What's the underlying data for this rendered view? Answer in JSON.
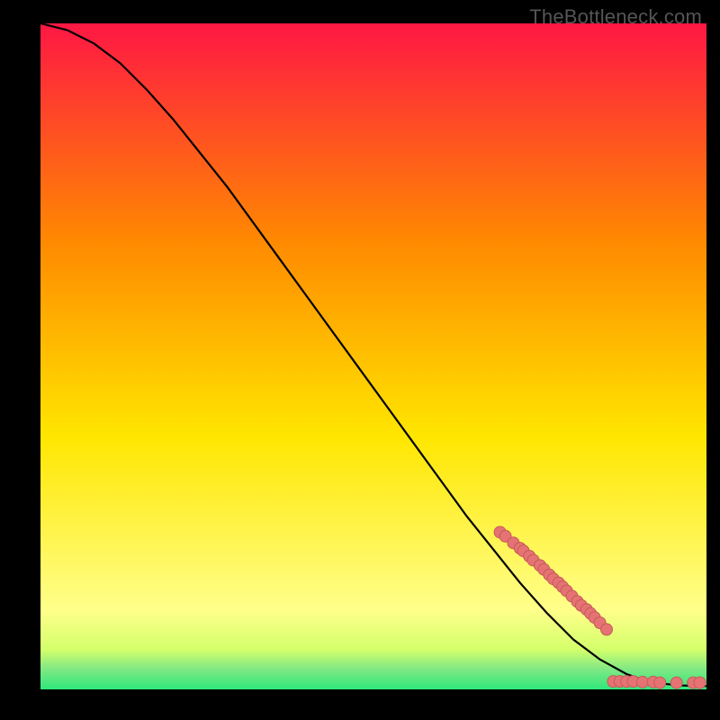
{
  "watermark": "TheBottleneck.com",
  "colors": {
    "background": "#000000",
    "line": "#000000",
    "scatter_fill": "#e57373",
    "scatter_stroke": "#c75a5a",
    "grad_top": "#ff1744",
    "grad_orange": "#ff8a00",
    "grad_yellow": "#ffe600",
    "grad_lime": "#d4ff6b",
    "grad_green": "#2ee87b"
  },
  "chart_data": {
    "type": "line",
    "title": "",
    "xlabel": "",
    "ylabel": "",
    "xlim": [
      0,
      100
    ],
    "ylim": [
      0,
      100
    ],
    "series": [
      {
        "name": "curve",
        "type": "line",
        "x": [
          0,
          4,
          8,
          12,
          16,
          20,
          24,
          28,
          32,
          36,
          40,
          44,
          48,
          52,
          56,
          60,
          64,
          68,
          72,
          76,
          80,
          84,
          88,
          90,
          92,
          94,
          96,
          98,
          100
        ],
        "y": [
          100,
          99,
          97,
          94,
          90,
          85.5,
          80.5,
          75.5,
          70,
          64.5,
          59,
          53.5,
          48,
          42.5,
          37,
          31.5,
          26,
          21,
          16,
          11.5,
          7.5,
          4.5,
          2.3,
          1.6,
          1.1,
          0.8,
          0.6,
          0.55,
          0.5
        ]
      },
      {
        "name": "scatter",
        "type": "scatter",
        "x": [
          69,
          69.8,
          71,
          72,
          72.5,
          73.4,
          74,
          75,
          75.6,
          76.4,
          77,
          77.8,
          78.4,
          79,
          79.8,
          80.6,
          81.2,
          82,
          82.6,
          83.2,
          84,
          85,
          86,
          87,
          88,
          89,
          90.4,
          92,
          93,
          95.5,
          98,
          99
        ],
        "y": [
          23.6,
          23,
          22,
          21.2,
          20.8,
          20,
          19.4,
          18.6,
          18,
          17.2,
          16.6,
          16,
          15.4,
          14.8,
          14,
          13.2,
          12.6,
          12,
          11.4,
          10.8,
          10,
          9,
          1.2,
          1.2,
          1.2,
          1.2,
          1.1,
          1.1,
          1,
          1,
          1,
          1
        ]
      }
    ]
  }
}
